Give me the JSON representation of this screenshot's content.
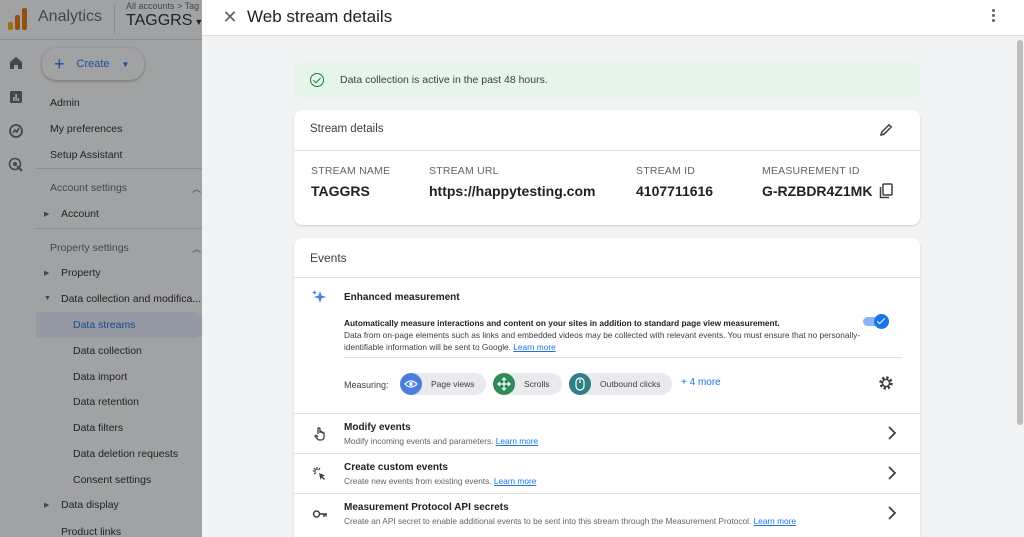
{
  "app": {
    "name": "Analytics",
    "account_crumb": "All accounts > Tag",
    "account_name": "TAGGRS"
  },
  "sidebar": {
    "create_label": "Create",
    "items": [
      {
        "label": "Admin"
      },
      {
        "label": "My preferences"
      },
      {
        "label": "Setup Assistant"
      }
    ],
    "account_settings": {
      "heading": "Account settings",
      "items": [
        {
          "label": "Account"
        }
      ]
    },
    "property_settings": {
      "heading": "Property settings",
      "items": [
        {
          "label": "Property"
        },
        {
          "label": "Data collection and modifica..."
        }
      ],
      "sub_items": [
        {
          "label": "Data streams"
        },
        {
          "label": "Data collection"
        },
        {
          "label": "Data import"
        },
        {
          "label": "Data retention"
        },
        {
          "label": "Data filters"
        },
        {
          "label": "Data deletion requests"
        },
        {
          "label": "Consent settings"
        }
      ]
    },
    "data_display": {
      "label": "Data display"
    },
    "product_links": {
      "label": "Product links"
    }
  },
  "drawer": {
    "title": "Web stream details"
  },
  "status": {
    "text": "Data collection is active in the past 48 hours."
  },
  "stream_details": {
    "title": "Stream details",
    "fields": [
      {
        "label": "STREAM NAME",
        "value": "TAGGRS"
      },
      {
        "label": "STREAM URL",
        "value": "https://happytesting.com"
      },
      {
        "label": "STREAM ID",
        "value": "4107711616"
      },
      {
        "label": "MEASUREMENT ID",
        "value": "G-RZBDR4Z1MK"
      }
    ]
  },
  "events": {
    "title": "Events",
    "enhanced": {
      "title": "Enhanced measurement",
      "desc_line1": "Automatically measure interactions and content on your sites in addition to standard page view measurement.",
      "desc_line2": "Data from on-page elements such as links and embedded videos may be collected with relevant events. You must ensure that no personally-identifiable information will be sent to Google.",
      "learn_more": "Learn more",
      "enabled": true,
      "measuring_label": "Measuring:",
      "chips": [
        {
          "label": "Page views",
          "color": "#4a7fdc"
        },
        {
          "label": "Scrolls",
          "color": "#2e8b57"
        },
        {
          "label": "Outbound clicks",
          "color": "#2f7f86"
        }
      ],
      "more_label": "+ 4 more"
    },
    "rows": [
      {
        "title": "Modify events",
        "desc": "Modify incoming events and parameters.",
        "link": "Learn more",
        "icon": "touch-icon"
      },
      {
        "title": "Create custom events",
        "desc": "Create new events from existing events.",
        "link": "Learn more",
        "icon": "sparkle-click-icon"
      },
      {
        "title": "Measurement Protocol API secrets",
        "desc": "Create an API secret to enable additional events to be sent into this stream through the Measurement Protocol.",
        "link": "Learn more",
        "icon": "key-icon"
      }
    ]
  }
}
